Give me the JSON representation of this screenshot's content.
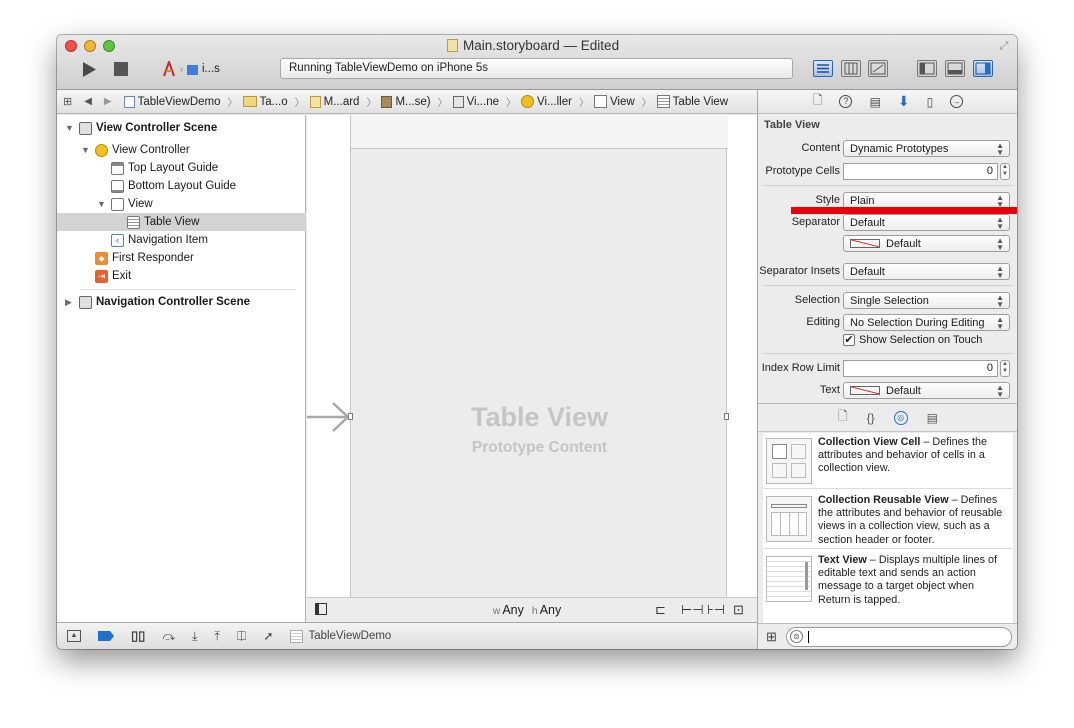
{
  "window": {
    "title": "Main.storyboard — Edited"
  },
  "toolbar": {
    "scheme": "i...s",
    "activity": "Running TableViewDemo on iPhone 5s"
  },
  "jumpbar": {
    "items": [
      "TableViewDemo",
      "Ta...o",
      "M...ard",
      "M...se)",
      "Vi...ne",
      "Vi...ller",
      "View",
      "Table View"
    ]
  },
  "navigator": {
    "rows": [
      {
        "label": "View Controller Scene"
      },
      {
        "label": "View Controller"
      },
      {
        "label": "Top Layout Guide"
      },
      {
        "label": "Bottom Layout Guide"
      },
      {
        "label": "View"
      },
      {
        "label": "Table View"
      },
      {
        "label": "Navigation Item"
      },
      {
        "label": "First Responder"
      },
      {
        "label": "Exit"
      },
      {
        "label": "Navigation Controller Scene"
      }
    ]
  },
  "canvas": {
    "title": "Table View",
    "subtitle": "Prototype Content",
    "size_w_prefix": "w",
    "size_w": "Any",
    "size_h_prefix": "h",
    "size_h": "Any"
  },
  "debugbar": {
    "target": "TableViewDemo"
  },
  "inspector": {
    "section": "Table View",
    "content_label": "Content",
    "content_value": "Dynamic Prototypes",
    "prototype_cells_label": "Prototype Cells",
    "prototype_cells_value": "0",
    "style_label": "Style",
    "style_value": "Plain",
    "separator_label": "Separator",
    "separator_value": "Default",
    "separator_color_value": "Default",
    "separator_insets_label": "Separator Insets",
    "separator_insets_value": "Default",
    "selection_label": "Selection",
    "selection_value": "Single Selection",
    "editing_label": "Editing",
    "editing_value": "No Selection During Editing",
    "show_selection_label": "Show Selection on Touch",
    "show_selection_checked": true,
    "index_row_limit_label": "Index Row Limit",
    "index_row_limit_value": "0",
    "text_label": "Text",
    "text_value": "Default"
  },
  "library": {
    "items": [
      {
        "title": "Collection View Cell",
        "desc": " – Defines the attributes and behavior of cells in a collection view."
      },
      {
        "title": "Collection Reusable View",
        "desc": " – Defines the attributes and behavior of reusable views in a collection view, such as a section header or footer."
      },
      {
        "title": "Text View",
        "desc": " – Displays multiple lines of editable text and sends an action message to a target object when Return is tapped."
      }
    ]
  },
  "colors": {
    "accent": "#1f6fd1",
    "annotation_red": "#e8000b"
  }
}
